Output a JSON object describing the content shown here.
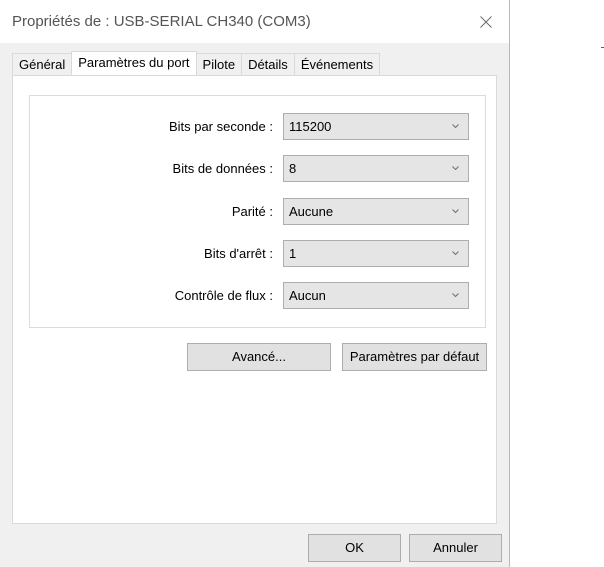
{
  "window": {
    "title": "Propriétés de : USB-SERIAL CH340 (COM3)"
  },
  "tabs": [
    {
      "label": "Général",
      "active": false
    },
    {
      "label": "Paramètres du port",
      "active": true
    },
    {
      "label": "Pilote",
      "active": false
    },
    {
      "label": "Détails",
      "active": false
    },
    {
      "label": "Événements",
      "active": false
    }
  ],
  "port_settings": [
    {
      "label": "Bits par seconde :",
      "value": "115200"
    },
    {
      "label": "Bits de données :",
      "value": "8"
    },
    {
      "label": "Parité :",
      "value": "Aucune"
    },
    {
      "label": "Bits d'arrêt :",
      "value": "1"
    },
    {
      "label": "Contrôle de flux :",
      "value": "Aucun"
    }
  ],
  "buttons": {
    "advanced": "Avancé...",
    "defaults": "Paramètres par défaut",
    "ok": "OK",
    "cancel": "Annuler"
  },
  "icons": {
    "close": "close-icon",
    "dropdown": "chevron-down-icon"
  },
  "colors": {
    "dialog_bg": "#f0f0f0",
    "panel_bg": "#ffffff",
    "field_bg": "#e5e5e5",
    "button_bg": "#e1e1e1",
    "accent": "#0078d7"
  }
}
